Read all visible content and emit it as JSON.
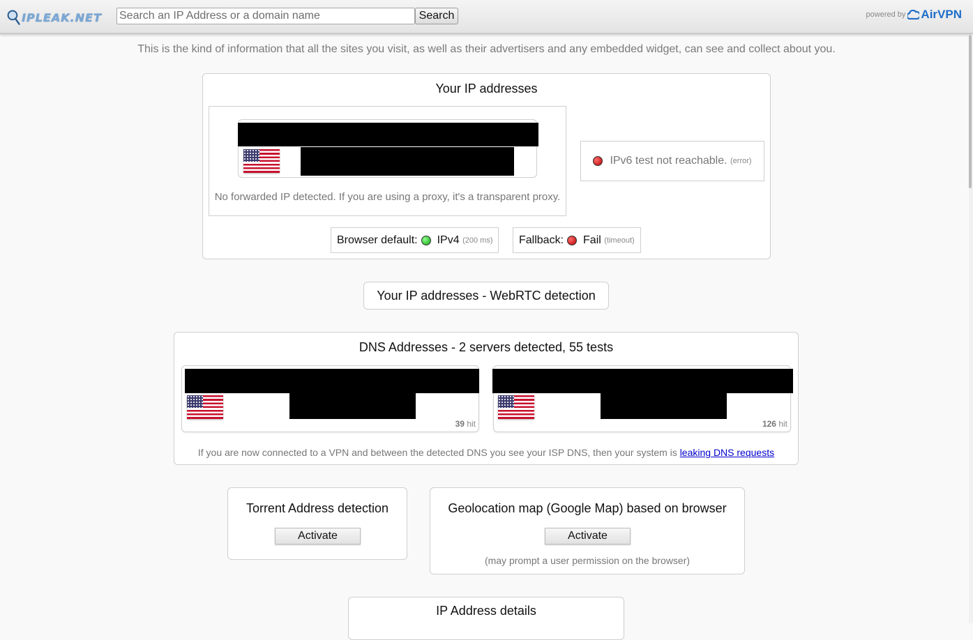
{
  "header": {
    "logo_text": "IPLEAK.NET",
    "search_placeholder": "Search an IP Address or a domain name",
    "search_value": "",
    "search_button": "Search",
    "powered_by": "powered by",
    "brand": "AirVPN"
  },
  "intro": "This is the kind of information that all the sites you visit, as well as their advertisers and any embedded widget, can see and collect about you.",
  "ip_section": {
    "title": "Your IP addresses",
    "no_forward_text": "No forwarded IP detected. If you are using a proxy, it's a transparent proxy.",
    "ipv6_text": "IPv6 test not reachable.",
    "ipv6_note": "(error)",
    "browser_default_label": "Browser default:",
    "browser_default_value": "IPv4",
    "browser_default_note": "(200 ms)",
    "fallback_label": "Fallback:",
    "fallback_value": "Fail",
    "fallback_note": "(timeout)"
  },
  "webrtc": {
    "label": "Your IP addresses - WebRTC detection"
  },
  "dns": {
    "title": "DNS Addresses - 2 servers detected, 55 tests",
    "servers": [
      {
        "hits": "39",
        "hit_label": "hit"
      },
      {
        "hits": "126",
        "hit_label": "hit"
      }
    ],
    "note": "If you are now connected to a VPN and between the detected DNS you see your ISP DNS, then your system is",
    "link": "leaking DNS requests"
  },
  "torrent": {
    "title": "Torrent Address detection",
    "button": "Activate"
  },
  "geo": {
    "title": "Geolocation map (Google Map) based on browser",
    "button": "Activate",
    "note": "(may prompt a user permission on the browser)"
  },
  "details": {
    "title": "IP Address details"
  },
  "colors": {
    "accent": "#1e6ec8",
    "status_red": "#b40000",
    "status_green": "#10a010"
  },
  "icons": [
    "magnifier-logo-icon",
    "airvpn-cloud-icon",
    "us-flag-icon",
    "status-dot-icon"
  ]
}
